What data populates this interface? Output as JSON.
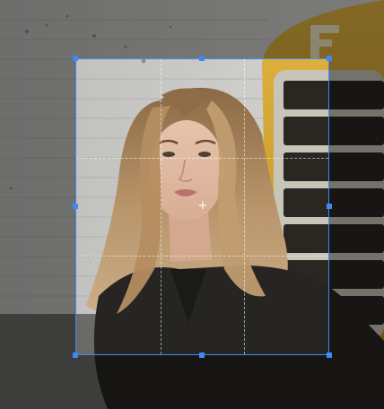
{
  "editor": {
    "mode": "crop",
    "grid": "rule-of-thirds",
    "accent_color": "#3d8bf2",
    "truck_letter": "F"
  },
  "icons": {
    "center_marker": "crosshair-icon",
    "center_glyph": "+"
  },
  "colors": {
    "overlay": "rgba(0,0,0,0.42)",
    "truck_yellow": "#d9a730",
    "wall": "#c9c9c7"
  }
}
